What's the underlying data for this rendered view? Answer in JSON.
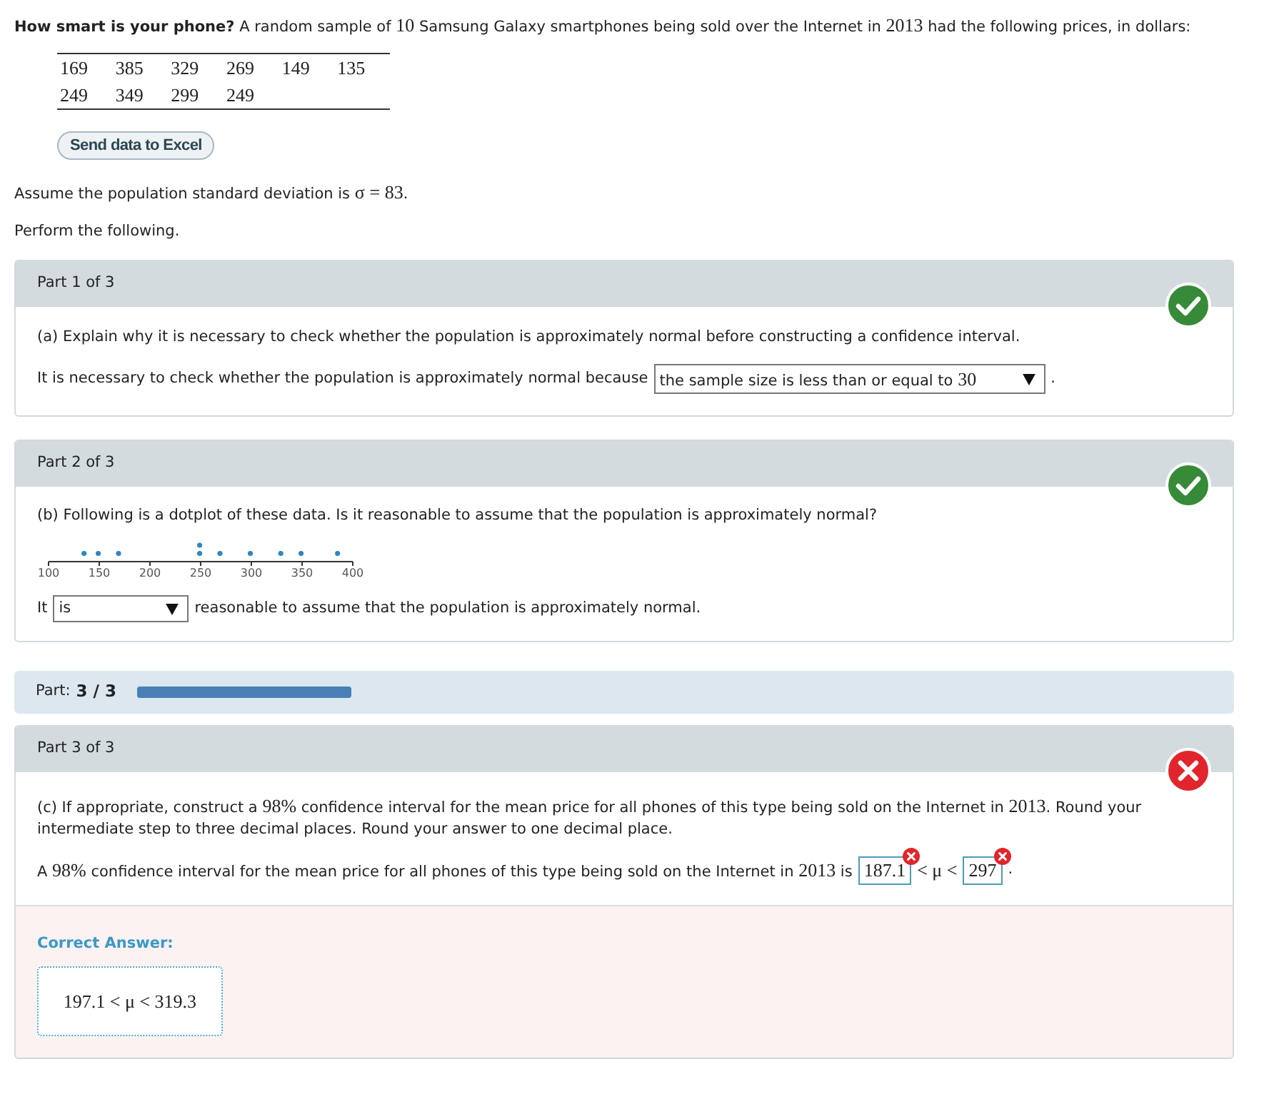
{
  "intro": {
    "text": "**How smart is your phone?** A random sample of 10 Samsung Galaxy smartphones being sold over the Internet in 2013 had the following prices, in dollars:"
  },
  "data_table": {
    "rows": [
      [
        "169",
        "385",
        "329",
        "269",
        "149",
        "135"
      ],
      [
        "249",
        "349",
        "299",
        "249"
      ]
    ]
  },
  "excel_button": {
    "label": "Send data to Excel"
  },
  "assumption": "Assume the population standard deviation is σ = 83.",
  "instruction": "Perform the following.",
  "sections": [
    {
      "kind": "part",
      "title": "Part 1 of 3",
      "correct": true,
      "question": "(a) Explain why it is necessary to check whether the population is approximately normal before constructing a confidence interval.",
      "answer_line": [
        {
          "kind": "text",
          "text": "It is necessary to check whether the population is approximately normal because"
        },
        {
          "kind": "select",
          "value": "the sample size is less than or equal to 30"
        },
        {
          "kind": "text",
          "text": "."
        }
      ]
    },
    {
      "kind": "part",
      "title": "Part 2 of 3",
      "correct": true,
      "question": "(b) Following is a dotplot of these data. Is it reasonable to assume that the population is approximately normal?",
      "dotplot": {
        "tick_labels": [
          "100",
          "150",
          "200",
          "250",
          "300",
          "350",
          "400"
        ]
      },
      "answer_line": [
        {
          "kind": "text",
          "text": "It"
        },
        {
          "kind": "select",
          "value": "is"
        },
        {
          "kind": "text",
          "text": "reasonable to assume that the population is approximately normal."
        }
      ]
    },
    {
      "kind": "progress",
      "label": "Part:",
      "value": "3 / 3",
      "level": 1
    },
    {
      "kind": "part",
      "title": "Part 3 of 3",
      "correct": false,
      "question": "(c) If appropriate, construct a 98% confidence interval for the mean price for all phones of this type being sold on the Internet in 2013. Round your intermediate step to three decimal places. Round your answer to one decimal place.",
      "answer_line": [
        {
          "kind": "text",
          "text": "A 98% confidence interval for the mean price for all phones of this type being sold on the Internet in 2013 is"
        },
        {
          "kind": "input",
          "value": "187.1",
          "correct": false
        },
        {
          "kind": "math",
          "text": "< μ <"
        },
        {
          "kind": "input",
          "value": "297",
          "correct": false
        },
        {
          "kind": "text",
          "text": "."
        }
      ],
      "correct_answer": {
        "label": "Correct Answer:",
        "value": "197.1 < μ < 319.3"
      }
    }
  ]
}
